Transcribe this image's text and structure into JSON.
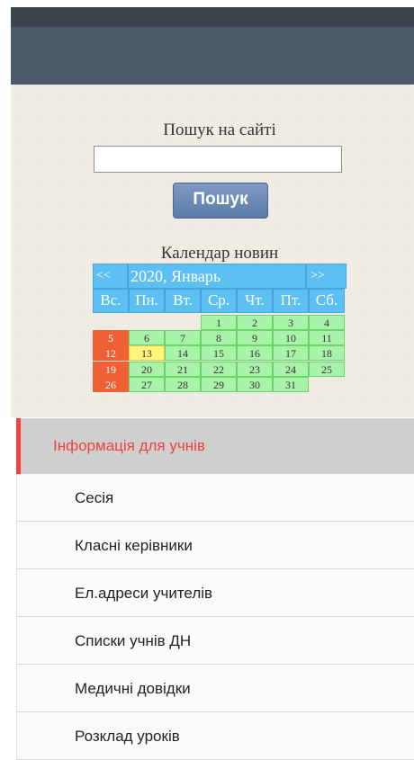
{
  "search": {
    "title": "Пошук на сайті",
    "placeholder": "",
    "button_label": "Пошук"
  },
  "calendar": {
    "title": "Календар новин",
    "prev_label": "<<",
    "next_label": ">>",
    "month_label": "2020, Январь",
    "weekdays": [
      "Вс.",
      "Пн.",
      "Вт.",
      "Ср.",
      "Чт.",
      "Пт.",
      "Сб."
    ],
    "weeks": [
      [
        "",
        "",
        "",
        "1",
        "2",
        "3",
        "4"
      ],
      [
        "5",
        "6",
        "7",
        "8",
        "9",
        "10",
        "11"
      ],
      [
        "12",
        "13",
        "14",
        "15",
        "16",
        "17",
        "18"
      ],
      [
        "19",
        "20",
        "21",
        "22",
        "23",
        "24",
        "25"
      ],
      [
        "26",
        "27",
        "28",
        "29",
        "30",
        "31",
        ""
      ]
    ],
    "today": "13",
    "colors": {
      "header": "#5cc0f2",
      "day": "#a9f2a9",
      "sunday": "#ef6135",
      "today": "#fff47c"
    }
  },
  "menu": {
    "active_label": "Інформація для учнів",
    "items": [
      "Сесія",
      "Класні керівники",
      "Ел.адреси учителів",
      "Списки учнів ДН",
      "Медичні довідки",
      "Розклад уроків"
    ],
    "active_color": "#f04141"
  }
}
